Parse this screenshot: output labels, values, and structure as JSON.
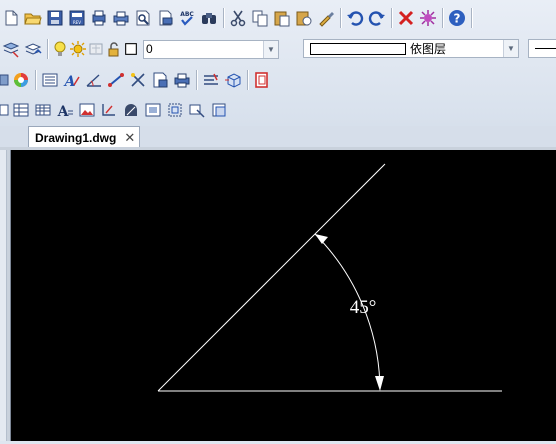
{
  "toolbar": {
    "layer_value": "0",
    "linetype_value": "依图层"
  },
  "document": {
    "tab_label": "Drawing1.dwg",
    "close_glyph": "✕"
  },
  "drawing": {
    "angle_label": "45°",
    "background": "#000000",
    "line_color": "#ffffff"
  }
}
